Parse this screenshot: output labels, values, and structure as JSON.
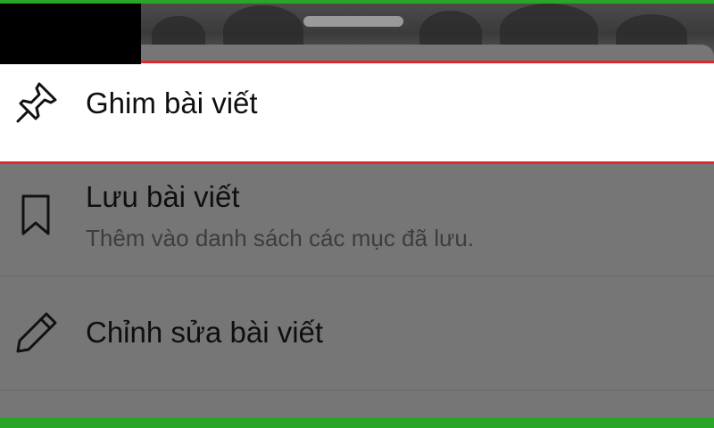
{
  "menu": {
    "pin": {
      "label": "Ghim bài viết",
      "icon": "pushpin-icon"
    },
    "save": {
      "label": "Lưu bài viết",
      "description": "Thêm vào danh sách các mục đã lưu.",
      "icon": "bookmark-icon"
    },
    "edit": {
      "label": "Chỉnh sửa bài viết",
      "icon": "pencil-icon"
    }
  },
  "colors": {
    "highlight_border": "#e0262a",
    "frame_border": "#2aa52a",
    "overlay": "#767676",
    "selected_background": "#ffffff"
  }
}
